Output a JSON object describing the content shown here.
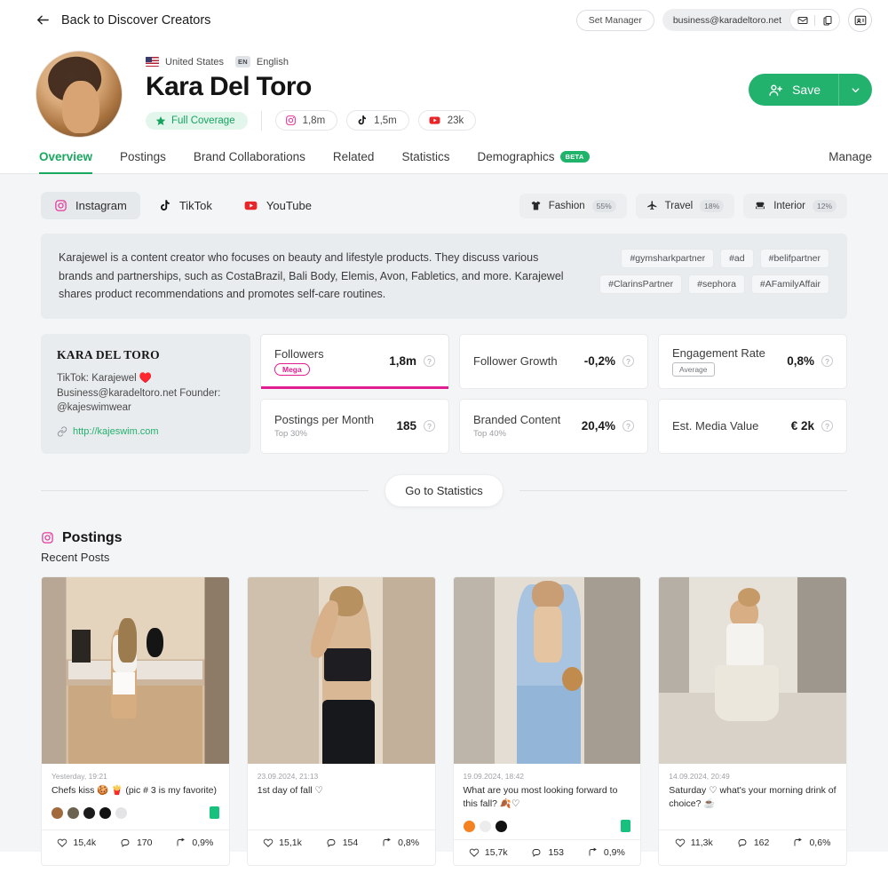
{
  "topbar": {
    "back_label": "Back to Discover Creators",
    "set_manager_label": "Set Manager",
    "email": "business@karadeltoro.net"
  },
  "profile": {
    "country": "United States",
    "lang_code": "EN",
    "language": "English",
    "name": "Kara Del Toro",
    "coverage_label": "Full Coverage",
    "socials": [
      {
        "network": "instagram",
        "count": "1,8m"
      },
      {
        "network": "tiktok",
        "count": "1,5m"
      },
      {
        "network": "youtube",
        "count": "23k"
      }
    ],
    "save_label": "Save"
  },
  "tabs": {
    "items": [
      {
        "label": "Overview",
        "active": true
      },
      {
        "label": "Postings",
        "active": false
      },
      {
        "label": "Brand Collaborations",
        "active": false
      },
      {
        "label": "Related",
        "active": false
      },
      {
        "label": "Statistics",
        "active": false
      },
      {
        "label": "Demographics",
        "active": false,
        "badge": "BETA"
      }
    ],
    "manage_label": "Manage"
  },
  "platforms": [
    {
      "label": "Instagram",
      "active": true
    },
    {
      "label": "TikTok",
      "active": false
    },
    {
      "label": "YouTube",
      "active": false
    }
  ],
  "topics": [
    {
      "label": "Fashion",
      "pct": "55%",
      "icon": "tshirt-icon"
    },
    {
      "label": "Travel",
      "pct": "18%",
      "icon": "plane-icon"
    },
    {
      "label": "Interior",
      "pct": "12%",
      "icon": "sofa-icon"
    }
  ],
  "description": {
    "text": "Karajewel is a content creator who focuses on beauty and lifestyle products. They discuss various brands and partnerships, such as CostaBrazil, Bali Body, Elemis, Avon, Fabletics, and more. Karajewel shares product recommendations and promotes self-care routines.",
    "tags": [
      "#gymsharkpartner",
      "#ad",
      "#belifpartner",
      "#ClarinsPartner",
      "#sephora",
      "#AFamilyAffair"
    ]
  },
  "bio": {
    "name": "KARA DEL TORO",
    "text": "TikTok: Karajewel ♥️\nBusiness@karadeltoro.net Founder:\n@kajeswimwear",
    "link": "http://kajeswim.com"
  },
  "stats": [
    {
      "label": "Followers",
      "chip": "Mega",
      "chip_style": "mega",
      "value": "1,8m",
      "highlight": true
    },
    {
      "label": "Follower Growth",
      "value": "-0,2%"
    },
    {
      "label": "Engagement Rate",
      "chip": "Average",
      "chip_style": "avg",
      "value": "0,8%"
    },
    {
      "label": "Postings per Month",
      "sub": "Top 30%",
      "value": "185"
    },
    {
      "label": "Branded Content",
      "sub": "Top 40%",
      "value": "20,4%"
    },
    {
      "label": "Est. Media Value",
      "value": "€ 2k"
    }
  ],
  "goto_statistics_label": "Go to Statistics",
  "postings": {
    "title": "Postings",
    "subtitle": "Recent Posts",
    "cards": [
      {
        "date": "Yesterday, 19:21",
        "caption": "Chefs kiss 🍪 🍟 (pic # 3 is my favorite)",
        "brand_dots": [
          "#a06a3c",
          "#6b6250",
          "#1b1b1b",
          "#111111",
          "#e2e4e6"
        ],
        "likes": "15,4k",
        "comments": "170",
        "engagement": "0,9%"
      },
      {
        "date": "23.09.2024, 21:13",
        "caption": "1st day of fall ♡",
        "brand_dots": [],
        "likes": "15,1k",
        "comments": "154",
        "engagement": "0,8%"
      },
      {
        "date": "19.09.2024, 18:42",
        "caption": "What are you most looking forward to this fall? 🍂♡",
        "brand_dots": [
          "#f58220",
          "#ececec",
          "#111111"
        ],
        "likes": "15,7k",
        "comments": "153",
        "engagement": "0,9%"
      },
      {
        "date": "14.09.2024, 20:49",
        "caption": "Saturday ♡ what's your morning drink of choice? ☕",
        "brand_dots": [],
        "likes": "11,3k",
        "comments": "162",
        "engagement": "0,6%"
      }
    ]
  },
  "colors": {
    "accent_green": "#23b26d",
    "accent_pink": "#e01e8f",
    "instagram": "#e1399b",
    "youtube": "#e8262a",
    "page_bg": "#f3f5f6"
  }
}
